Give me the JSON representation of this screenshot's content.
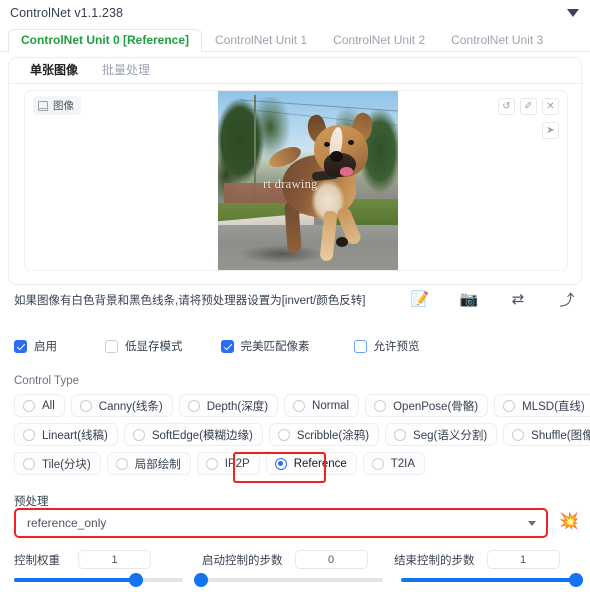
{
  "header": {
    "title": "ControlNet v1.1.238",
    "collapse_icon": "triangle-down-icon"
  },
  "unit_tabs": [
    {
      "label": "ControlNet Unit 0 [Reference]",
      "active": true
    },
    {
      "label": "ControlNet Unit 1",
      "active": false
    },
    {
      "label": "ControlNet Unit 2",
      "active": false
    },
    {
      "label": "ControlNet Unit 3",
      "active": false
    }
  ],
  "sub_tabs": [
    {
      "label": "单张图像",
      "active": true
    },
    {
      "label": "批量处理",
      "active": false
    }
  ],
  "image_area": {
    "chip_label": "图像",
    "chip_icon": "image-icon",
    "watermark": "rt drawing",
    "tools": [
      {
        "name": "undo-icon",
        "glyph": "↺"
      },
      {
        "name": "erase-icon",
        "glyph": "✐"
      },
      {
        "name": "close-icon",
        "glyph": "✕"
      }
    ],
    "tool_secondary": {
      "name": "cursor-select-icon",
      "glyph": "➤"
    }
  },
  "hint": {
    "text": "如果图像有白色背景和黑色线条,请将预处理器设置为[invert/颜色反转]",
    "icons": [
      {
        "name": "edit-note-icon",
        "glyph": "📝"
      },
      {
        "name": "camera-icon",
        "glyph": "📷"
      },
      {
        "name": "swap-arrows-icon",
        "glyph": "⇄"
      },
      {
        "name": "send-arrow-icon",
        "glyph": "⤴"
      }
    ]
  },
  "checkboxes": [
    {
      "label": "启用",
      "checked": true,
      "style": "blue"
    },
    {
      "label": "低显存模式",
      "checked": false,
      "style": "grey"
    },
    {
      "label": "完美匹配像素",
      "checked": true,
      "style": "blue"
    },
    {
      "label": "允许预览",
      "checked": false,
      "style": "blue-outline"
    }
  ],
  "control_type": {
    "label": "Control Type",
    "selected": "Reference",
    "rows": [
      [
        {
          "label": "All",
          "selected": false
        },
        {
          "label": "Canny(线条)",
          "selected": false
        },
        {
          "label": "Depth(深度)",
          "selected": false
        },
        {
          "label": "Normal",
          "selected": false
        },
        {
          "label": "OpenPose(骨骼)",
          "selected": false
        },
        {
          "label": "MLSD(直线)",
          "selected": false
        }
      ],
      [
        {
          "label": "Lineart(线稿)",
          "selected": false
        },
        {
          "label": "SoftEdge(模糊边缘)",
          "selected": false
        },
        {
          "label": "Scribble(涂鸦)",
          "selected": false
        },
        {
          "label": "Seg(语义分割)",
          "selected": false
        },
        {
          "label": "Shuffle(图像打乱)",
          "selected": false
        }
      ],
      [
        {
          "label": "Tile(分块)",
          "selected": false
        },
        {
          "label": "局部绘制",
          "selected": false
        },
        {
          "label": "IP2P",
          "selected": false
        },
        {
          "label": "Reference",
          "selected": true
        },
        {
          "label": "T2IA",
          "selected": false
        }
      ]
    ]
  },
  "preprocessor": {
    "label": "预处理",
    "value": "reference_only",
    "caret_icon": "chevron-down-icon",
    "action_icon": "explosion-icon",
    "action_glyph": "💥"
  },
  "sliders": [
    {
      "label": "控制权重",
      "value": "1",
      "percent": 72
    },
    {
      "label": "启动控制的步数",
      "value": "0",
      "percent": 0
    },
    {
      "label": "结束控制的步数",
      "value": "1",
      "percent": 100
    }
  ],
  "colors": {
    "accent_blue": "#1473f0",
    "active_tab_green": "#1f9d3f",
    "highlight_red": "#f42020",
    "checkbox_blue": "#2b6cf6"
  }
}
